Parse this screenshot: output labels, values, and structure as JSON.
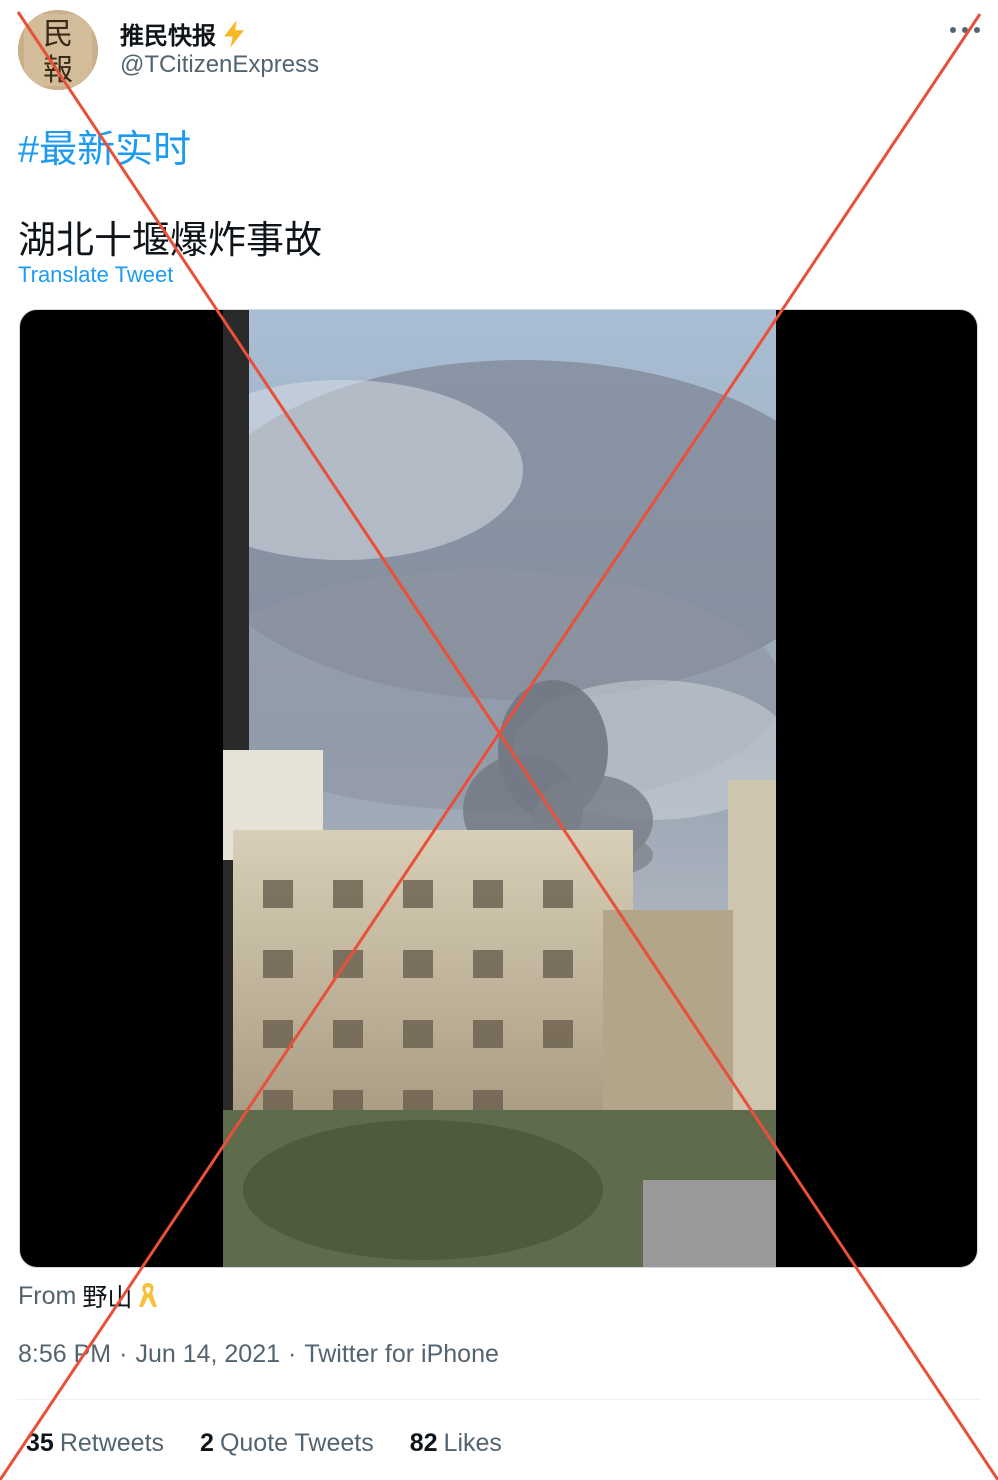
{
  "author": {
    "display_name": "推民快报",
    "handle": "@TCitizenExpress",
    "avatar_glyphs": [
      "民",
      "報"
    ]
  },
  "tweet": {
    "hashtag": "#最新实时",
    "text": "湖北十堰爆炸事故",
    "translate_label": "Translate Tweet"
  },
  "media": {
    "type": "video"
  },
  "attribution": {
    "prefix": "From",
    "name": "野山"
  },
  "meta": {
    "time": "8:56 PM",
    "separator": "·",
    "date": "Jun 14, 2021",
    "source": "Twitter for iPhone"
  },
  "stats": [
    {
      "count": "35",
      "label": "Retweets"
    },
    {
      "count": "2",
      "label": "Quote Tweets"
    },
    {
      "count": "82",
      "label": "Likes"
    }
  ],
  "icons": {
    "verified_emoji": "bolt-icon",
    "more": "more-icon",
    "ribbon": "ribbon-icon"
  },
  "colors": {
    "link": "#1d9bf0",
    "secondary_text": "#536471",
    "cross_overlay": "#e8503a"
  }
}
